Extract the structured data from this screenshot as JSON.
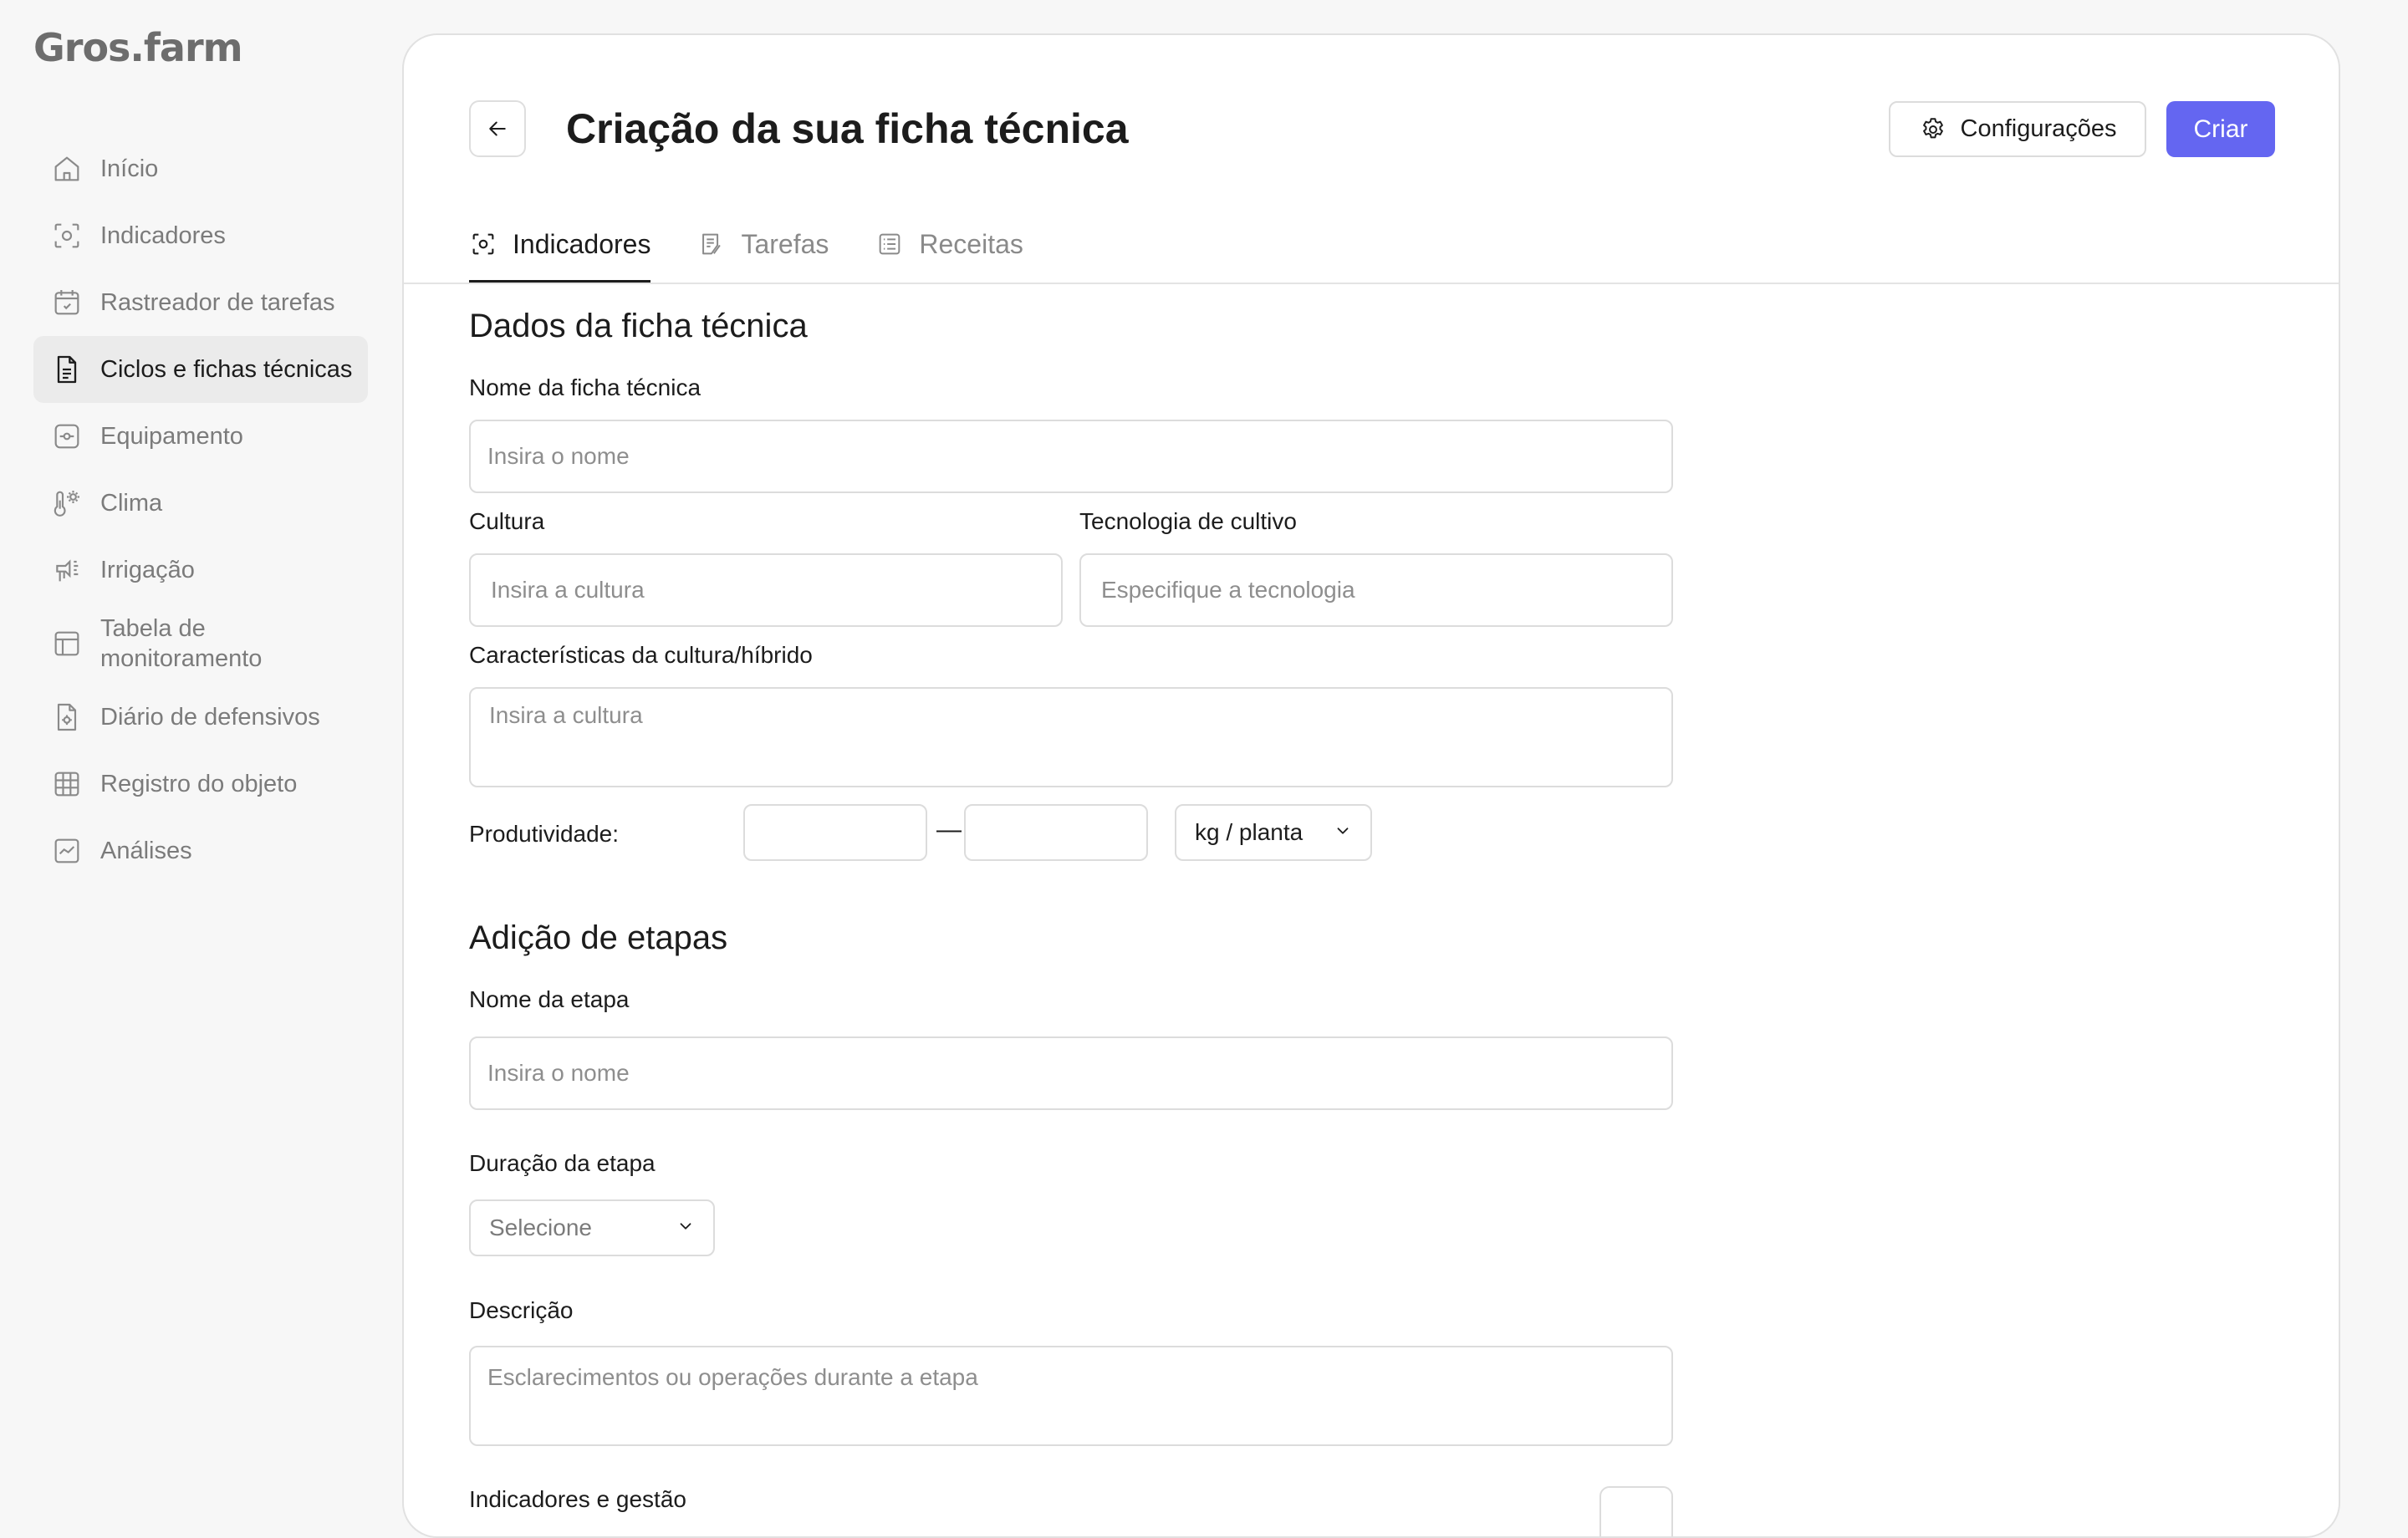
{
  "app": {
    "logo": "Gros.farm"
  },
  "sidebar": {
    "items": [
      {
        "label": "Início",
        "icon": "home-icon"
      },
      {
        "label": "Indicadores",
        "icon": "indicators-icon"
      },
      {
        "label": "Rastreador de tarefas",
        "icon": "calendar-check-icon"
      },
      {
        "label": "Ciclos e fichas técnicas",
        "icon": "document-icon",
        "active": true
      },
      {
        "label": "Equipamento",
        "icon": "equipment-icon"
      },
      {
        "label": "Clima",
        "icon": "thermometer-sun-icon"
      },
      {
        "label": "Irrigação",
        "icon": "irrigation-icon"
      },
      {
        "label": "Tabela de monitoramento",
        "icon": "table-icon"
      },
      {
        "label": "Diário de defensivos",
        "icon": "pesticide-diary-icon"
      },
      {
        "label": "Registro do objeto",
        "icon": "grid-icon"
      },
      {
        "label": "Análises",
        "icon": "chart-icon"
      }
    ]
  },
  "header": {
    "title": "Criação da sua ficha técnica",
    "config_label": "Configurações",
    "create_label": "Criar"
  },
  "tabs": [
    {
      "label": "Indicadores",
      "active": true
    },
    {
      "label": "Tarefas"
    },
    {
      "label": "Receitas"
    }
  ],
  "form": {
    "section1_title": "Dados da ficha técnica",
    "name_label": "Nome da ficha técnica",
    "name_placeholder": "Insira o nome",
    "culture_label": "Cultura",
    "culture_placeholder": "Insira a cultura",
    "tech_label": "Tecnologia de cultivo",
    "tech_placeholder": "Especifique a tecnologia",
    "characteristics_label": "Características da cultura/híbrido",
    "characteristics_placeholder": "Insira a cultura",
    "productivity_label": "Produtividade:",
    "productivity_min": "",
    "productivity_max": "",
    "productivity_separator": "—",
    "productivity_unit": "kg / planta",
    "section2_title": "Adição de etapas",
    "stage_name_label": "Nome da etapa",
    "stage_name_placeholder": "Insira o nome",
    "stage_duration_label": "Duração da etapa",
    "stage_duration_value": "Selecione",
    "description_label": "Descrição",
    "description_placeholder": "Esclarecimentos ou operações durante a etapa",
    "indicators_label": "Indicadores e gestão"
  },
  "colors": {
    "accent": "#6466f1",
    "active_nav_bg": "#ebebeb"
  }
}
